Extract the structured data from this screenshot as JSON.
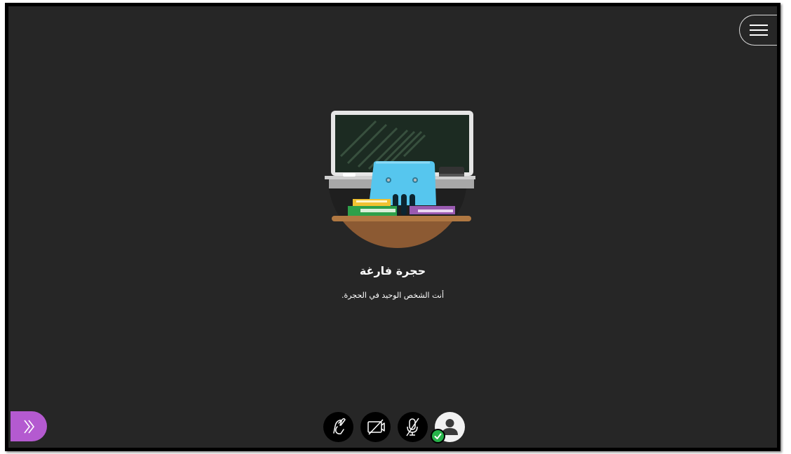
{
  "room": {
    "title": "حجرة فارغة",
    "subtitle": "أنت الشخص الوحيد في الحجرة."
  },
  "icons": {
    "menu": "hamburger-menu-icon",
    "expand": "double-chevron-right-icon",
    "hand": "raise-hand-icon",
    "camera": "camera-off-icon",
    "mic": "microphone-off-icon",
    "avatar": "user-avatar-icon",
    "status": "checkmark-icon"
  },
  "colors": {
    "stage_background": "#262626",
    "accent_purple": "#b45ad0",
    "status_green": "#27b34a"
  }
}
